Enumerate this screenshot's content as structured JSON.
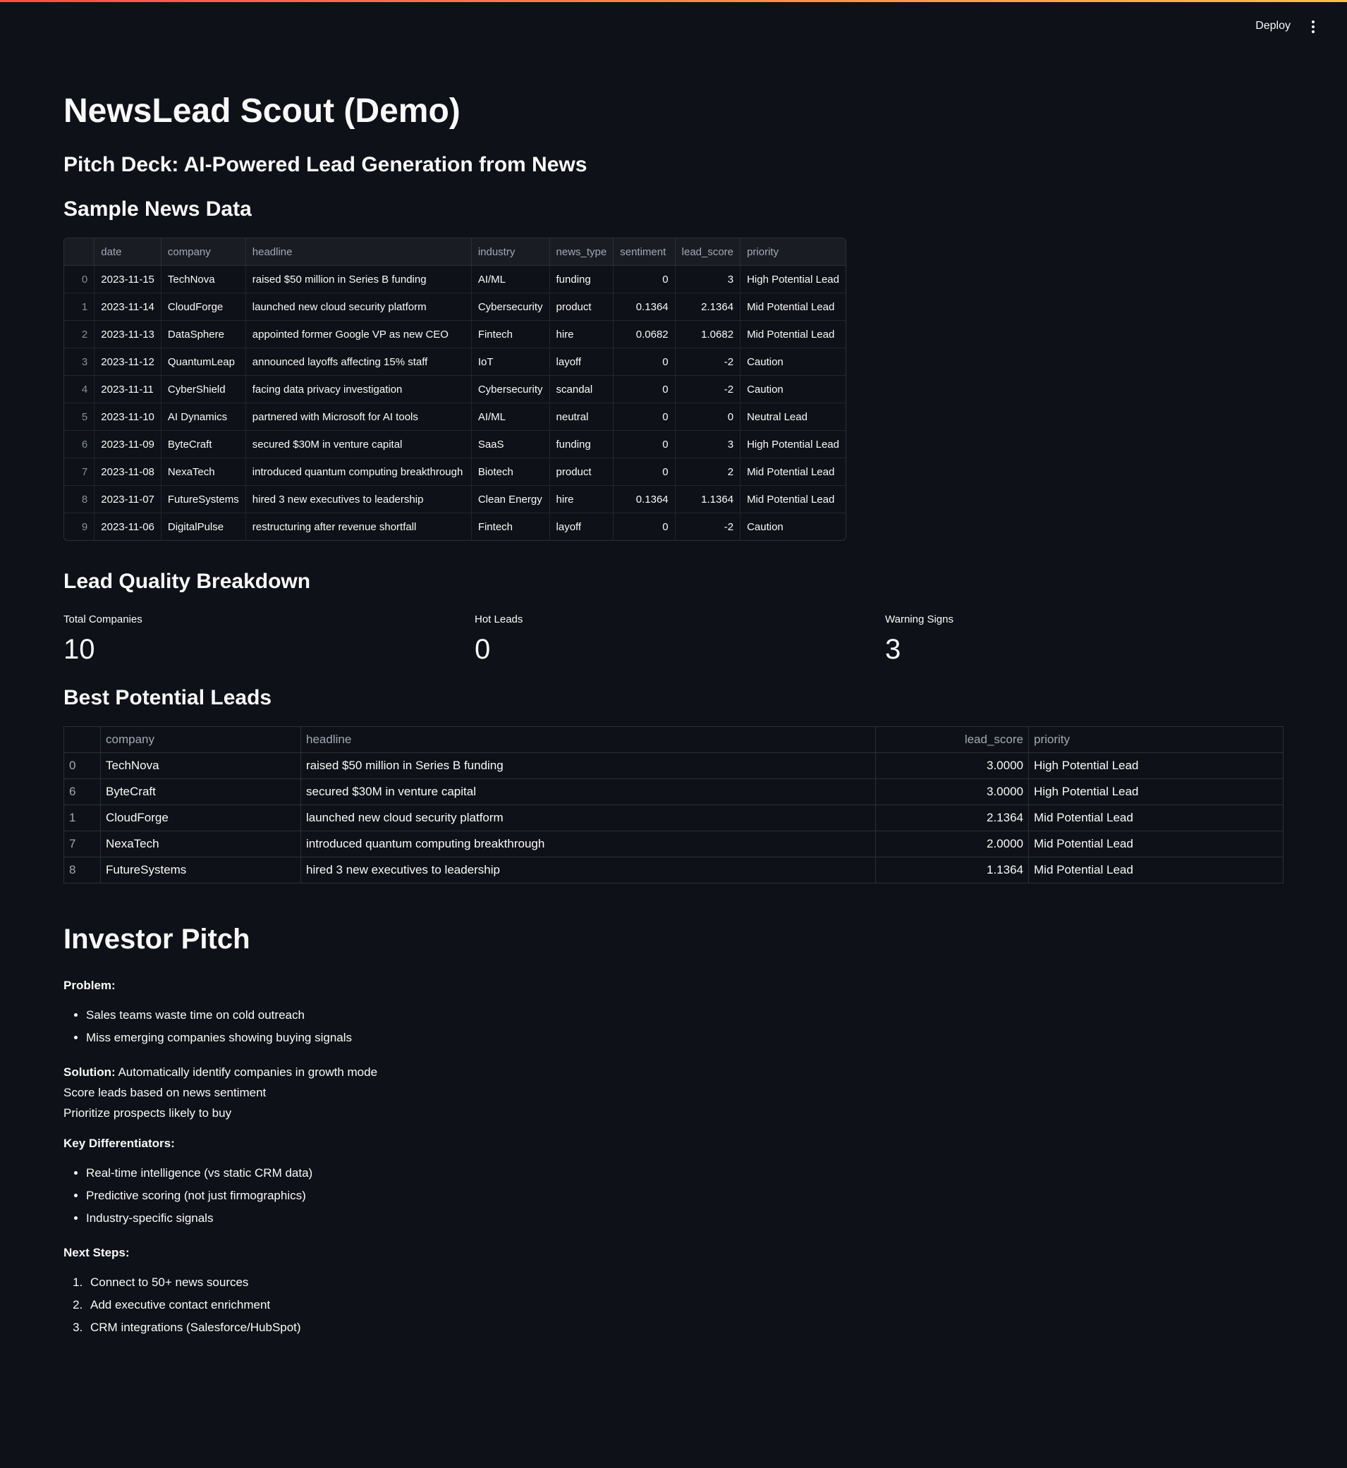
{
  "header": {
    "deploy_label": "Deploy",
    "menu_icon": "vertical-ellipsis-icon"
  },
  "page": {
    "title": "NewsLead Scout (Demo)",
    "subtitle": "Pitch Deck: AI-Powered Lead Generation from News"
  },
  "news": {
    "heading": "Sample News Data",
    "columns": [
      "",
      "date",
      "company",
      "headline",
      "industry",
      "news_type",
      "sentiment",
      "lead_score",
      "priority"
    ],
    "rows": [
      [
        "0",
        "2023-11-15",
        "TechNova",
        "raised $50 million in Series B funding",
        "AI/ML",
        "funding",
        "0",
        "3",
        "High Potential Lead"
      ],
      [
        "1",
        "2023-11-14",
        "CloudForge",
        "launched new cloud security platform",
        "Cybersecurity",
        "product",
        "0.1364",
        "2.1364",
        "Mid Potential Lead"
      ],
      [
        "2",
        "2023-11-13",
        "DataSphere",
        "appointed former Google VP as new CEO",
        "Fintech",
        "hire",
        "0.0682",
        "1.0682",
        "Mid Potential Lead"
      ],
      [
        "3",
        "2023-11-12",
        "QuantumLeap",
        "announced layoffs affecting 15% staff",
        "IoT",
        "layoff",
        "0",
        "-2",
        "Caution"
      ],
      [
        "4",
        "2023-11-11",
        "CyberShield",
        "facing data privacy investigation",
        "Cybersecurity",
        "scandal",
        "0",
        "-2",
        "Caution"
      ],
      [
        "5",
        "2023-11-10",
        "AI Dynamics",
        "partnered with Microsoft for AI tools",
        "AI/ML",
        "neutral",
        "0",
        "0",
        "Neutral Lead"
      ],
      [
        "6",
        "2023-11-09",
        "ByteCraft",
        "secured $30M in venture capital",
        "SaaS",
        "funding",
        "0",
        "3",
        "High Potential Lead"
      ],
      [
        "7",
        "2023-11-08",
        "NexaTech",
        "introduced quantum computing breakthrough",
        "Biotech",
        "product",
        "0",
        "2",
        "Mid Potential Lead"
      ],
      [
        "8",
        "2023-11-07",
        "FutureSystems",
        "hired 3 new executives to leadership",
        "Clean Energy",
        "hire",
        "0.1364",
        "1.1364",
        "Mid Potential Lead"
      ],
      [
        "9",
        "2023-11-06",
        "DigitalPulse",
        "restructuring after revenue shortfall",
        "Fintech",
        "layoff",
        "0",
        "-2",
        "Caution"
      ]
    ]
  },
  "breakdown": {
    "heading": "Lead Quality Breakdown",
    "metrics": [
      {
        "label": "Total Companies",
        "value": "10"
      },
      {
        "label": "Hot Leads",
        "value": "0"
      },
      {
        "label": "Warning Signs",
        "value": "3"
      }
    ]
  },
  "best": {
    "heading": "Best Potential Leads",
    "columns": [
      "",
      "company",
      "headline",
      "lead_score",
      "priority"
    ],
    "rows": [
      [
        "0",
        "TechNova",
        "raised $50 million in Series B funding",
        "3.0000",
        "High Potential Lead"
      ],
      [
        "6",
        "ByteCraft",
        "secured $30M in venture capital",
        "3.0000",
        "High Potential Lead"
      ],
      [
        "1",
        "CloudForge",
        "launched new cloud security platform",
        "2.1364",
        "Mid Potential Lead"
      ],
      [
        "7",
        "NexaTech",
        "introduced quantum computing breakthrough",
        "2.0000",
        "Mid Potential Lead"
      ],
      [
        "8",
        "FutureSystems",
        "hired 3 new executives to leadership",
        "1.1364",
        "Mid Potential Lead"
      ]
    ]
  },
  "pitch": {
    "heading": "Investor Pitch",
    "problem_label": "Problem:",
    "problem_items": [
      "Sales teams waste time on cold outreach",
      "Miss emerging companies showing buying signals"
    ],
    "solution_label": "Solution:",
    "solution_text": "Automatically identify companies in growth mode",
    "solution_lines": [
      "Score leads based on news sentiment",
      "Prioritize prospects likely to buy"
    ],
    "diff_label": "Key Differentiators:",
    "diff_items": [
      "Real-time intelligence (vs static CRM data)",
      "Predictive scoring (not just firmographics)",
      "Industry-specific signals"
    ],
    "next_label": "Next Steps:",
    "next_items": [
      "Connect to 50+ news sources",
      "Add executive contact enrichment",
      "CRM integrations (Salesforce/HubSpot)"
    ]
  }
}
